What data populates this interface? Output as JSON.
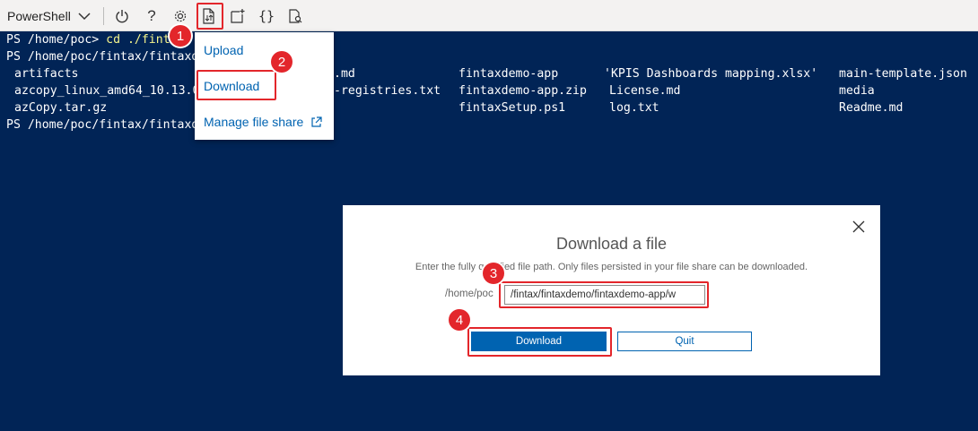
{
  "toolbar": {
    "shell_label": "PowerShell",
    "icons": [
      "power-icon",
      "help-icon",
      "settings-icon",
      "upload-download-icon",
      "new-session-icon",
      "editor-icon",
      "web-preview-icon"
    ],
    "help_glyph": "?",
    "braces_glyph": "{}"
  },
  "terminal": {
    "lines": [
      {
        "prompt": "PS /home/poc> ",
        "command": "cd ./fintax"
      },
      {
        "prompt": "PS /home/poc/fintax/fintaxdemo> "
      }
    ],
    "listing": {
      "col1": [
        "artifacts",
        "azcopy_linux_amd64_10.13.0",
        "azCopy.tar.gz"
      ],
      "col2": [
        ".md",
        "-registries.txt",
        ""
      ],
      "col3": [
        "fintaxdemo-app",
        "fintaxdemo-app.zip",
        "fintaxSetup.ps1"
      ],
      "col4": [
        "'KPIS Dashboards mapping.xlsx'",
        "License.md",
        "log.txt"
      ],
      "col5": [
        "main-template.json",
        "media",
        "Readme.md"
      ]
    },
    "last_prompt": "PS /home/poc/fintax/fintaxdemo> "
  },
  "menu": {
    "items": [
      {
        "label": "Upload"
      },
      {
        "label": "Download"
      },
      {
        "label": "Manage file share",
        "icon": "external-link-icon"
      }
    ]
  },
  "dialog": {
    "title": "Download a file",
    "description": "Enter the fully qualified file path. Only files persisted in your file share can be downloaded.",
    "prefix": "/home/poc",
    "input_value": "/fintax/fintaxdemo/fintaxdemo-app/w",
    "primary_label": "Download",
    "secondary_label": "Quit"
  },
  "markers": [
    "1",
    "2",
    "3",
    "4"
  ],
  "colors": {
    "terminal_bg": "#012456",
    "accent": "#0063b1",
    "marker": "#e3262b",
    "command": "#f5f58c"
  }
}
